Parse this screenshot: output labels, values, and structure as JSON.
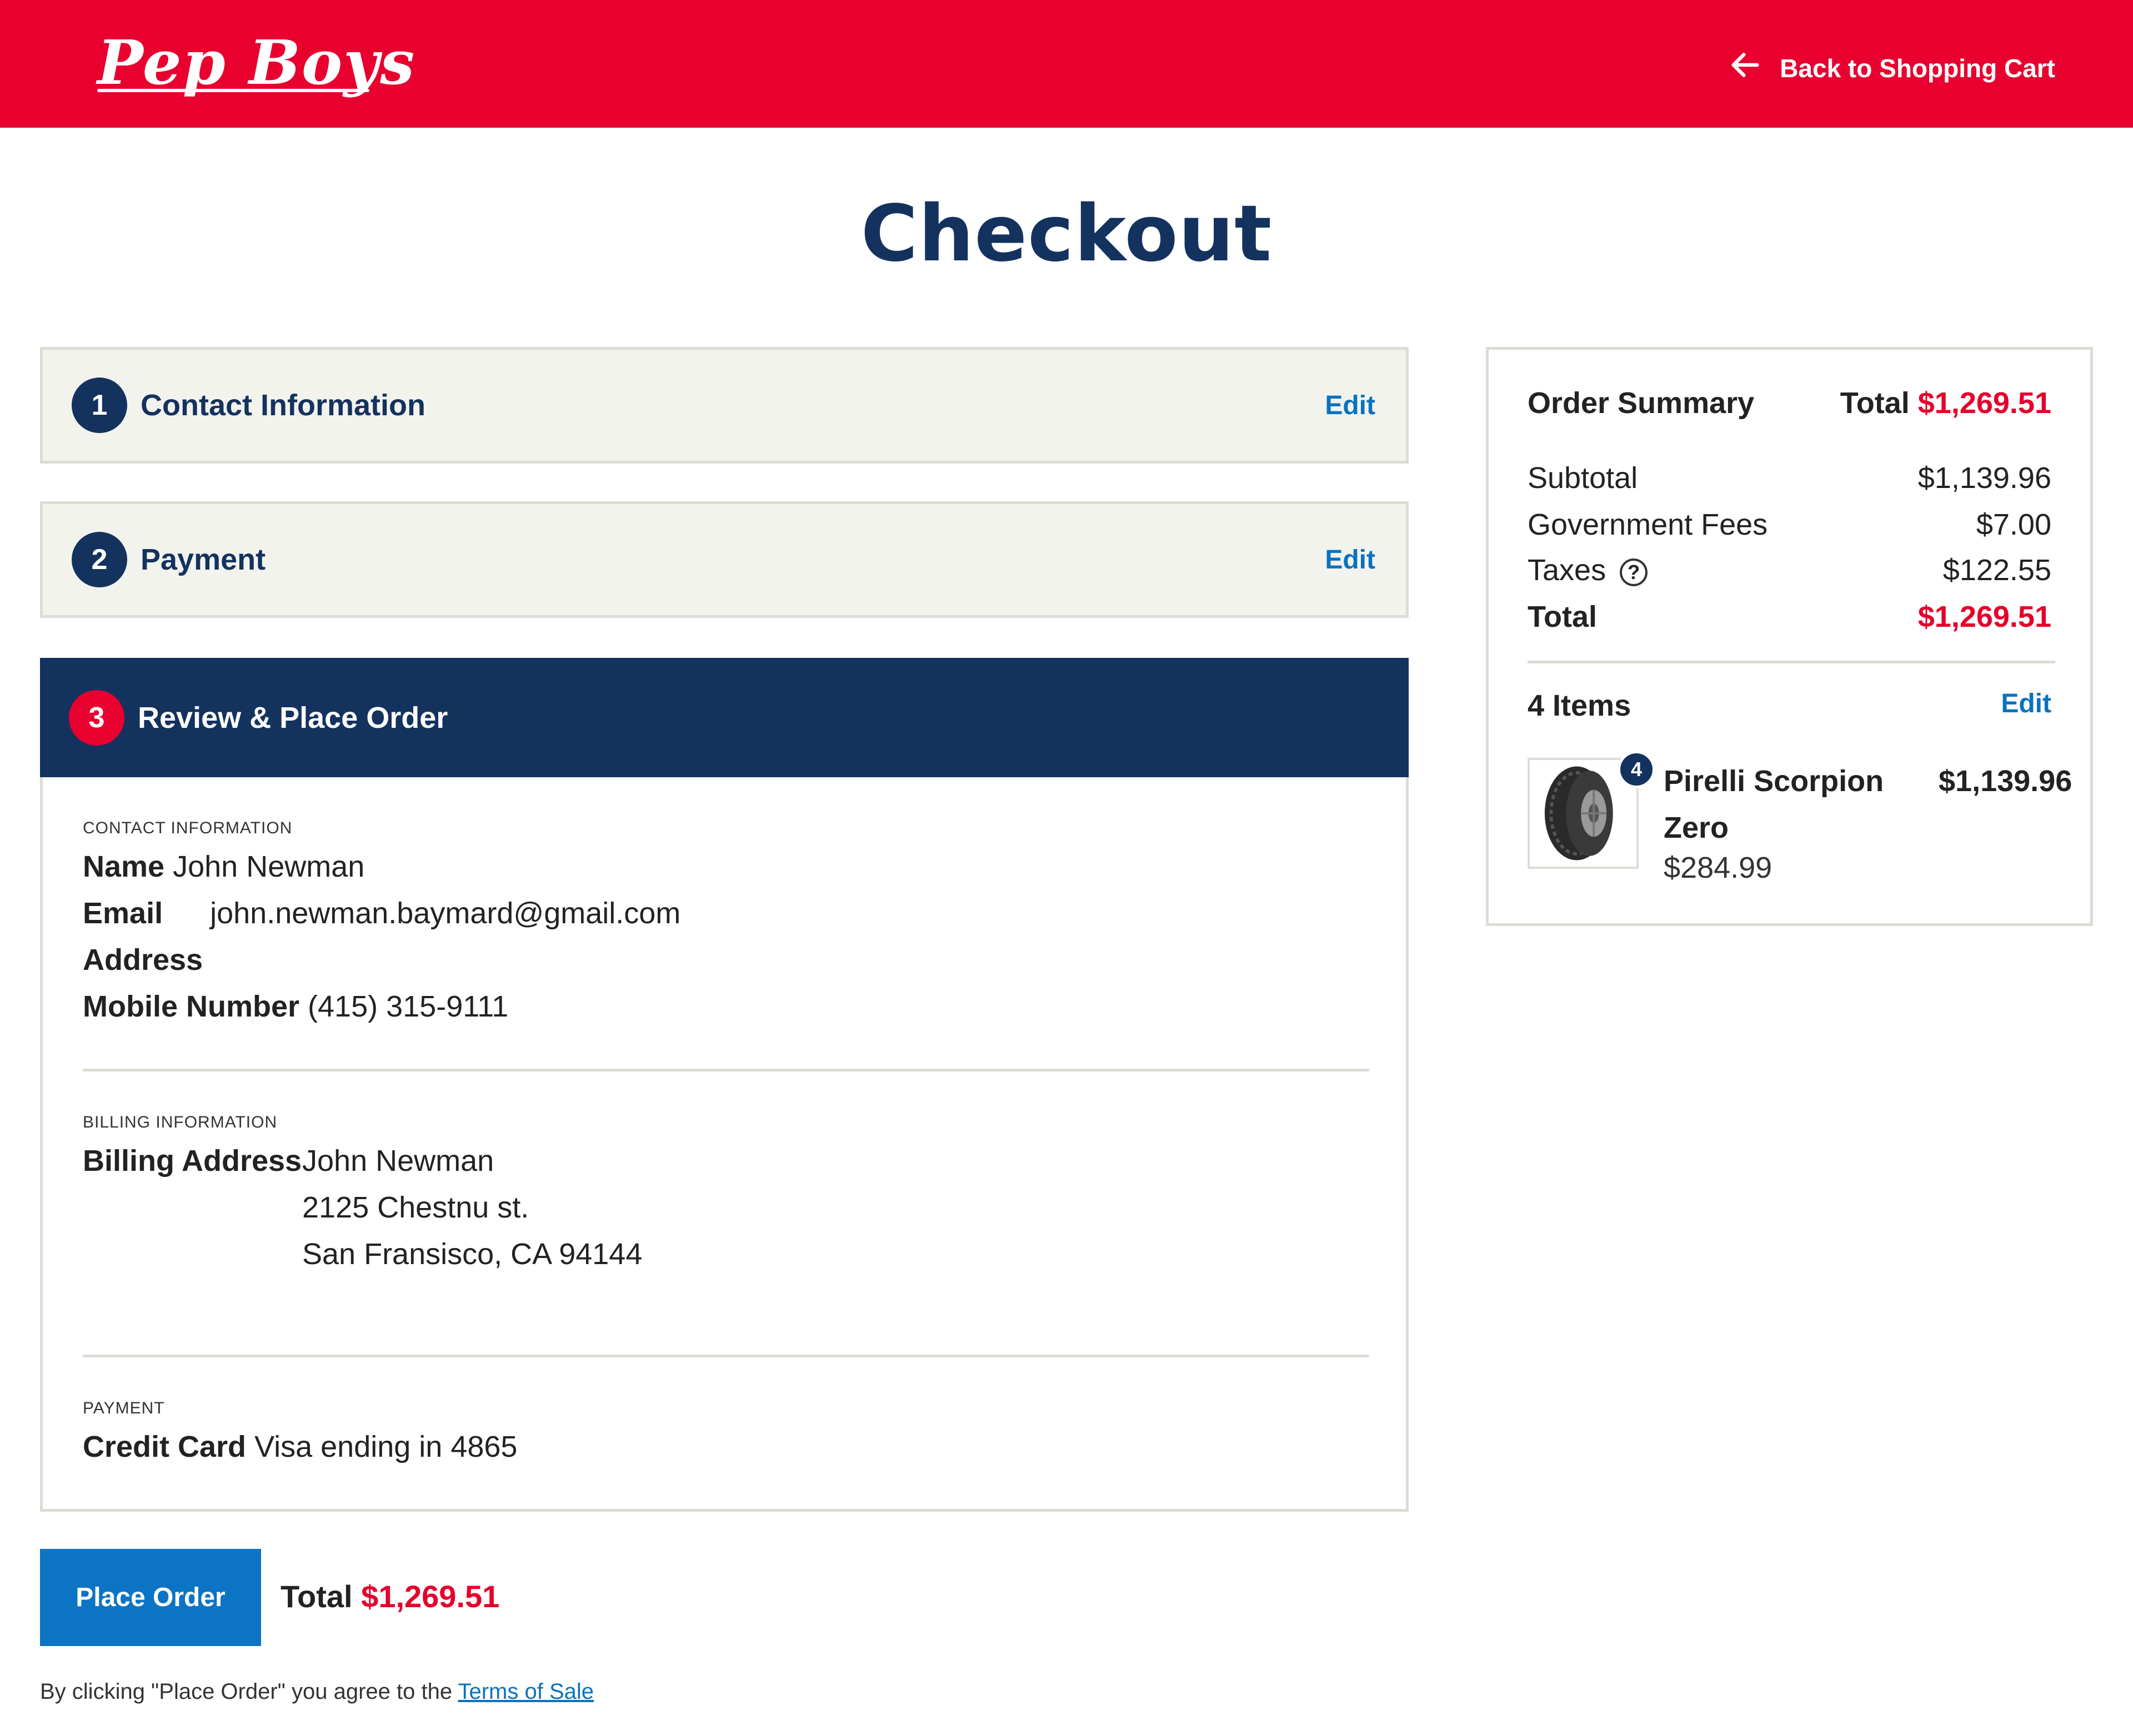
{
  "header": {
    "logo": "Pep Boys",
    "back_link": "Back to Shopping Cart"
  },
  "page_title": "Checkout",
  "steps": [
    {
      "number": "1",
      "title": "Contact Information",
      "edit": "Edit"
    },
    {
      "number": "2",
      "title": "Payment",
      "edit": "Edit"
    },
    {
      "number": "3",
      "title": "Review & Place Order"
    }
  ],
  "review": {
    "contact_label": "CONTACT INFORMATION",
    "name_label": "Name",
    "name_value": "John Newman",
    "email_label": "Email",
    "email_value": "john.newman.baymard@gmail.com",
    "address_label": "Address",
    "mobile_label": "Mobile Number",
    "mobile_value": "(415) 315-9111",
    "billing_label": "BILLING INFORMATION",
    "billing_address_label": "Billing Address",
    "billing_lines": [
      "John Newman",
      "2125 Chestnu st.",
      "San Fransisco, CA 94144"
    ],
    "payment_label": "PAYMENT",
    "card_label": "Credit Card",
    "card_value": "Visa ending in 4865"
  },
  "place_order": {
    "button": "Place Order",
    "total_label": "Total",
    "total_value": "$1,269.51",
    "terms_text": "By clicking \"Place Order\" you agree to the",
    "terms_link": "Terms of Sale"
  },
  "summary": {
    "title": "Order Summary",
    "total_label": "Total",
    "total_value": "$1,269.51",
    "subtotal_label": "Subtotal",
    "subtotal_value": "$1,139.96",
    "fees_label": "Government Fees",
    "fees_value": "$7.00",
    "taxes_label": "Taxes",
    "taxes_info": "?",
    "taxes_value": "$122.55",
    "grand_label": "Total",
    "grand_value": "$1,269.51",
    "items_label": "4 Items",
    "items_edit": "Edit",
    "item": {
      "quantity": "4",
      "name": "Pirelli Scorpion Zero",
      "unit_price": "$284.99",
      "line_price": "$1,139.96"
    }
  },
  "colors": {
    "brand_red": "#e8002f",
    "navy": "#14325e",
    "link_blue": "#0a72bf",
    "button_blue": "#0b74c4",
    "price_red": "#e4002b"
  }
}
